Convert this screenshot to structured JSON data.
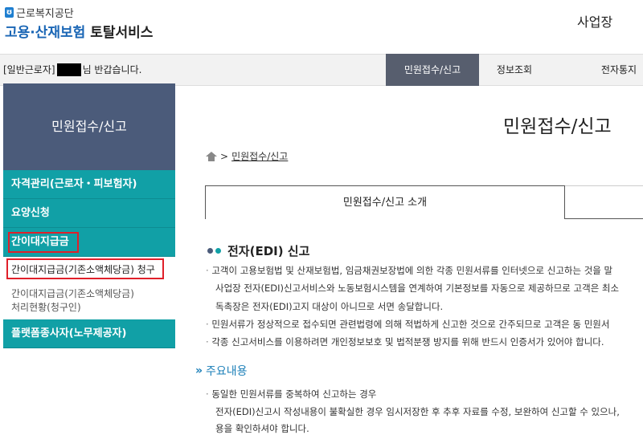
{
  "header": {
    "org_name": "근로복지공단",
    "service_name_blue": "고용·산재보험",
    "service_name_dark": "토탈서비스",
    "workplace_label": "사업장"
  },
  "topbar": {
    "greeting_prefix": "[일반근로자]",
    "greeting_suffix": "님 반갑습니다.",
    "nav": [
      "민원접수/신고",
      "정보조회",
      "전자통지"
    ]
  },
  "sidebar": {
    "heading": "민원접수/신고",
    "items": [
      {
        "label": "자격관리(근로자・피보험자)"
      },
      {
        "label": "요양신청"
      },
      {
        "label": "간이대지급금"
      },
      {
        "label": "플랫폼종사자(노무제공자)"
      }
    ],
    "sub_items": [
      {
        "label": "간이대지급금(기존소액체당금) 청구"
      },
      {
        "label_line1": "간이대지급금(기존소액체당금)",
        "label_line2": "처리현황(청구인)"
      }
    ]
  },
  "main": {
    "page_title": "민원접수/신고",
    "breadcrumb": "민원접수/신고",
    "tab_active": "민원접수/신고 소개",
    "section_title": "전자(EDI) 신고",
    "paragraphs": [
      "고객이 고용보험법 및 산재보험법, 임금채권보장법에 의한 각종 민원서류를 인터넷으로 신고하는 것을 말",
      "사업장 전자(EDI)신고서비스와 노동보험시스템을 연계하여 기본정보를 자동으로 제공하므로 고객은 최소",
      "독촉장은 전자(EDI)고지 대상이 아니므로 서면 송달합니다.",
      "민원서류가 정상적으로 접수되면 관련법령에 의해 적법하게 신고한 것으로 간주되므로 고객은 동 민원서",
      "각종 신고서비스를 이용하려면 개인정보보호 및 법적분쟁 방지를 위해 반드시 인증서가 있어야 합니다."
    ],
    "subsection_title": "주요내용",
    "sub_paragraphs": [
      "동일한 민원서류를 중복하여 신고하는 경우",
      "전자(EDI)신고시 작성내용이 불확실한 경우 임시저장한 후 추후 자료를 수정, 보완하여 신고할 수 있으나,",
      "용을 확인하셔야 합니다."
    ]
  },
  "colors": {
    "sidebar_teal": "#11a0a6",
    "sidebar_head": "#4b5b7a",
    "nav_active": "#575e6e",
    "highlight_box": "#e0202a",
    "logo_blue": "#1a66b5"
  }
}
